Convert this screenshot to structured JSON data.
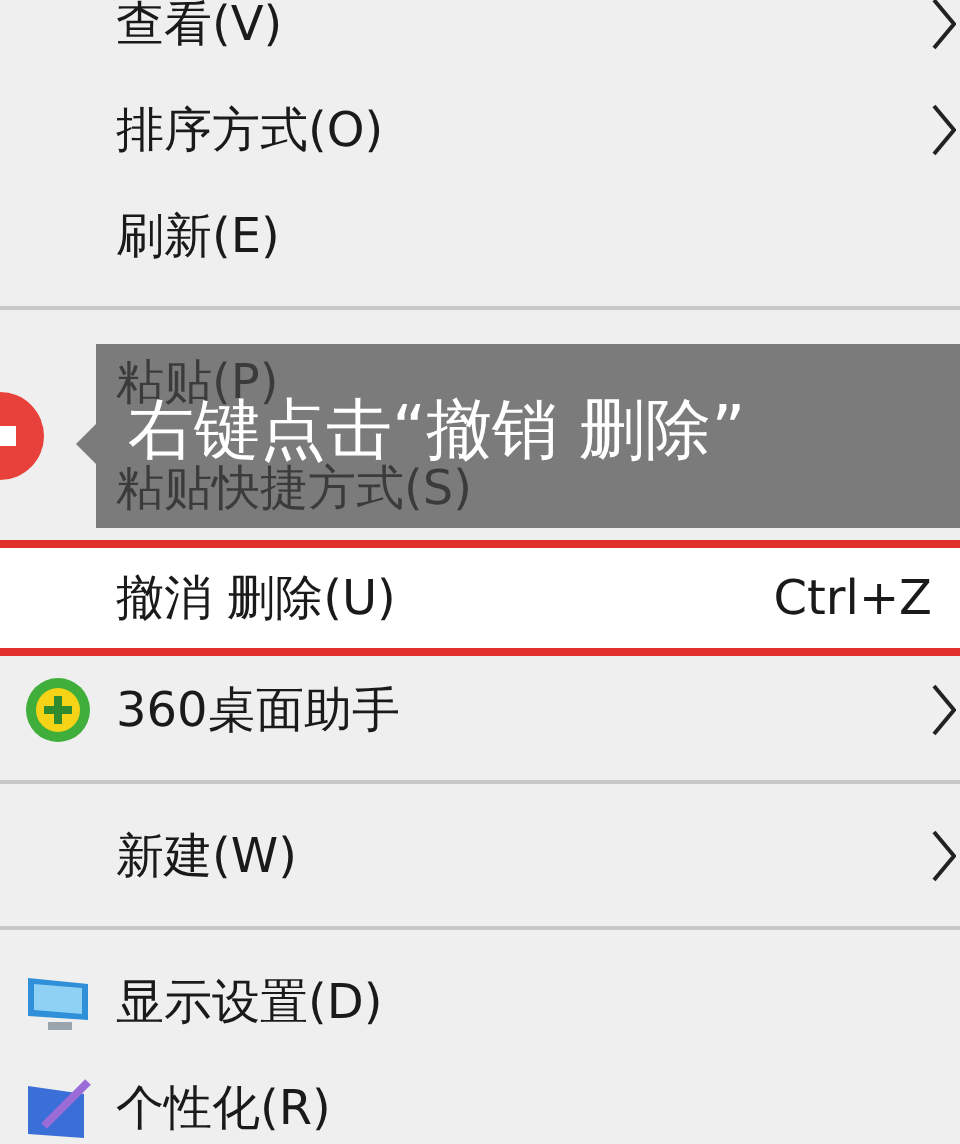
{
  "menu": {
    "items": [
      {
        "kind": "text",
        "label": "查看(V)",
        "submenu": true,
        "highlighted": false
      },
      {
        "kind": "text",
        "label": "排序方式(O)",
        "submenu": true,
        "highlighted": false
      },
      {
        "kind": "text",
        "label": "刷新(E)",
        "submenu": false,
        "highlighted": false
      },
      {
        "kind": "separator"
      },
      {
        "kind": "text",
        "label": "粘贴(P)",
        "submenu": false,
        "highlighted": false
      },
      {
        "kind": "text",
        "label": "粘贴快捷方式(S)",
        "submenu": false,
        "highlighted": false
      },
      {
        "kind": "text",
        "label": "撤消 删除(U)",
        "shortcut": "Ctrl+Z",
        "submenu": false,
        "highlighted": true
      },
      {
        "kind": "app",
        "label": "360桌面助手",
        "submenu": true,
        "highlighted": false
      },
      {
        "kind": "separator"
      },
      {
        "kind": "text",
        "label": "新建(W)",
        "submenu": true,
        "highlighted": false
      },
      {
        "kind": "separator"
      },
      {
        "kind": "display",
        "label": "显示设置(D)",
        "submenu": false,
        "highlighted": false
      },
      {
        "kind": "personalize",
        "label": "个性化(R)",
        "submenu": false,
        "highlighted": false
      }
    ]
  },
  "callout": {
    "text": "右键点击“撤销 删除”"
  }
}
